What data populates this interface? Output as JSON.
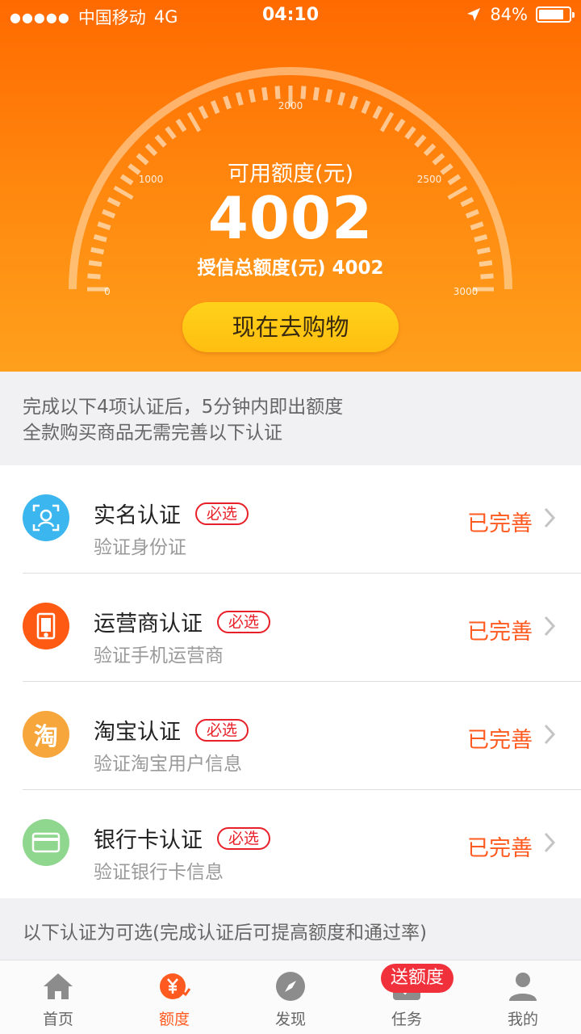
{
  "status_bar": {
    "signal": "●●●●●",
    "carrier": "中国移动",
    "network": "4G",
    "time": "04:10",
    "battery_text": "84%",
    "battery_level": 0.84
  },
  "gauge": {
    "tick_labels": [
      "0",
      "1000",
      "2000",
      "2500",
      "3000"
    ],
    "available_label": "可用额度(元)",
    "available_value": "4002",
    "total_label": "授信总额度(元) 4002"
  },
  "shop_button_label": "现在去购物",
  "notice": {
    "line1": "完成以下4项认证后，5分钟内即出额度",
    "line2": "全款购买商品无需完善以下认证"
  },
  "certifications": [
    {
      "title": "实名认证",
      "badge": "必选",
      "subtitle": "验证身份证",
      "status": "已完善",
      "icon": "face-scan-icon",
      "color": "#3cb6ee"
    },
    {
      "title": "运营商认证",
      "badge": "必选",
      "subtitle": "验证手机运营商",
      "status": "已完善",
      "icon": "phone-icon",
      "color": "#ff5a14"
    },
    {
      "title": "淘宝认证",
      "badge": "必选",
      "subtitle": "验证淘宝用户信息",
      "status": "已完善",
      "icon": "taobao-icon",
      "color": "#f7a63c",
      "icon_text": "淘"
    },
    {
      "title": "银行卡认证",
      "badge": "必选",
      "subtitle": "验证银行卡信息",
      "status": "已完善",
      "icon": "bank-card-icon",
      "color": "#8fd68f"
    }
  ],
  "optional_note": "以下认证为可选(完成认证后可提高额度和通过率)",
  "tabs": [
    {
      "label": "首页",
      "icon": "home-icon"
    },
    {
      "label": "额度",
      "icon": "credit-icon",
      "active": true
    },
    {
      "label": "发现",
      "icon": "compass-icon"
    },
    {
      "label": "任务",
      "icon": "task-icon",
      "badge": "送额度"
    },
    {
      "label": "我的",
      "icon": "user-icon"
    }
  ],
  "colors": {
    "accent": "#ff5a1f",
    "required": "#e8202a",
    "header_top": "#ff6a00",
    "header_bottom": "#ffa01c",
    "button": "#ffc814"
  }
}
